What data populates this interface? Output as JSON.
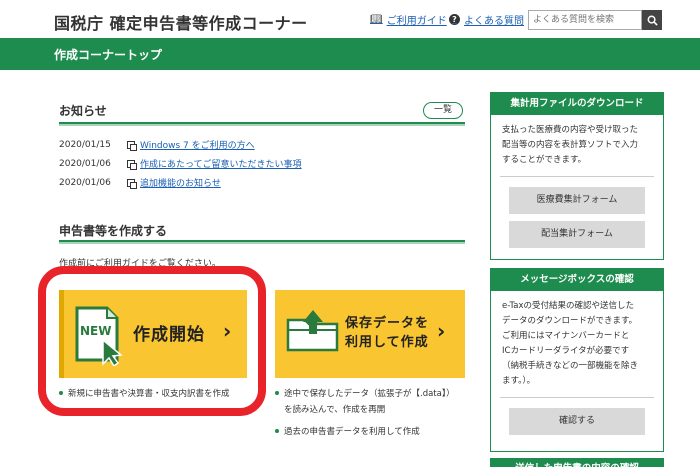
{
  "header": {
    "site_title": "国税庁 確定申告書等作成コーナー",
    "guide_link": "ご利用ガイド",
    "faq_link": "よくある質問",
    "search_placeholder": "よくある質問を検索"
  },
  "band": {
    "title": "作成コーナートップ"
  },
  "news": {
    "heading": "お知らせ",
    "list_button": "一覧",
    "items": [
      {
        "date": "2020/01/15",
        "text": "Windows 7 をご利用の方へ"
      },
      {
        "date": "2020/01/06",
        "text": "作成にあたってご留意いただきたい事項"
      },
      {
        "date": "2020/01/06",
        "text": "追加機能のお知らせ"
      }
    ]
  },
  "create": {
    "heading": "申告書等を作成する",
    "intro": "作成前にご利用ガイドをご覧ください。",
    "new_card": {
      "badge": "NEW",
      "label": "作成開始"
    },
    "resume_card": {
      "line1": "保存データを",
      "line2": "利用して作成"
    },
    "new_bullet": "新規に申告書や決算書・収支内訳書を作成",
    "resume_bullets": [
      "途中で保存したデータ（拡張子が【.data】）",
      "を読み込んで、作成を再開",
      "過去の申告書データを利用して作成"
    ]
  },
  "sidebar": {
    "aggregate": {
      "title": "集計用ファイルのダウンロード",
      "text": [
        "支払った医療費の内容や受け取った",
        "配当等の内容を表計算ソフトで入力",
        "することができます。"
      ],
      "button1": "医療費集計フォーム",
      "button2": "配当集計フォーム"
    },
    "messagebox": {
      "title": "メッセージボックスの確認",
      "text": [
        "e-Taxの受付結果の確認や送信した",
        "データのダウンロードができます。",
        "ご利用にはマイナンバーカードと",
        "ICカードリーダライタが必要です",
        "（納税手続きなどの一部機能を除き",
        "ます。）。"
      ],
      "button": "確認する"
    },
    "next_title": "送信した申告書の内容の確認"
  },
  "colors": {
    "brand_green": "#1e8c4e",
    "card_yellow": "#f9c530",
    "highlight_red": "#e8232a"
  }
}
